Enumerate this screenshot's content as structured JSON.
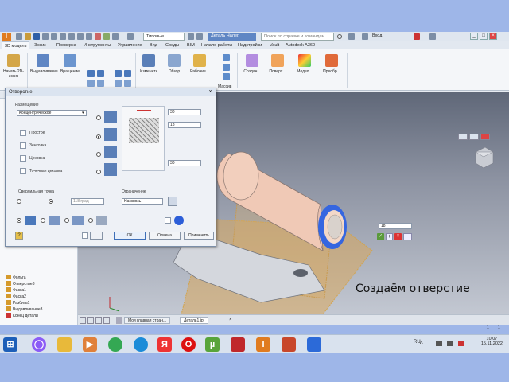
{
  "titlebar": {
    "style_select": "Типовые",
    "doc_title": "Деталь Налег.",
    "search_placeholder": "Поиск по справке и командам",
    "user": "Вход",
    "min": "_",
    "max": "□",
    "close": "×"
  },
  "tabs": [
    "3D модель",
    "Эскиз",
    "Проверка",
    "Инструменты",
    "Управление",
    "Вид",
    "Среды",
    "BIM",
    "Начало работы",
    "Надстройки",
    "Vault",
    "Autodesk A360"
  ],
  "ribbon": {
    "buttons": [
      "Начать 2D-эскиз",
      "Выдавливание",
      "Вращение",
      "Изменить",
      "Обзор",
      "Рабочие...",
      "Создан...",
      "Поверх...",
      "Модел...",
      "Преобр..."
    ],
    "group_label": "Массив"
  },
  "browser_items": [
    "Фольга",
    "Отверстие3",
    "Фаска1",
    "Фаска2",
    "Разбить1",
    "Выдавливание3",
    "Конец детали"
  ],
  "dialog": {
    "title": "Отверстие",
    "placement_label": "Размещение",
    "placement_value": "Концентрическое",
    "type_options": [
      "Простое",
      "Зенковка",
      "Цековка",
      "Точечная цековка"
    ],
    "drill_point_label": "Сверлильная точка",
    "drill_point_value": "118 град",
    "termination_label": "Ограничение",
    "termination_value": "Насквозь",
    "dim_values": [
      "30",
      "18",
      "30"
    ],
    "ok": "ОК",
    "cancel": "Отмена",
    "apply": "Применить"
  },
  "minitoolbar": {
    "value": "18"
  },
  "doc_tabs": [
    "Моя главная стран...",
    "Деталь1.ipt"
  ],
  "caption": "Создаём отверстие",
  "tray": {
    "lang": "RU",
    "time": "10:07",
    "date": "15.11.2022",
    "pages": [
      "1",
      "1"
    ]
  },
  "colors": {
    "accent": "#3d6fb8",
    "part": "#f0c9b6",
    "hole_ring": "#2c5ed8"
  }
}
